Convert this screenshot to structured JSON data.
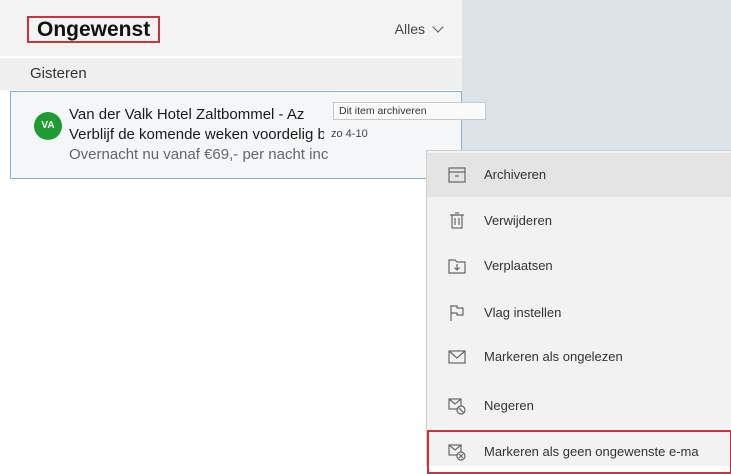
{
  "header": {
    "folder_title": "Ongewenst",
    "filter_label": "Alles"
  },
  "group_header": "Gisteren",
  "mail_item": {
    "avatar_initials": "VA",
    "avatar_color": "#1e9c33",
    "sender": "Van der Valk Hotel Zaltbommel - Az",
    "subject": "Verblijf de komende weken voordelig b",
    "preview": "Overnacht nu vanaf €69,- per nacht inc",
    "date": "zo 4-10"
  },
  "tooltip": "Dit item archiveren",
  "context_menu": {
    "items": [
      {
        "label": "Archiveren",
        "icon": "archive-icon"
      },
      {
        "label": "Verwijderen",
        "icon": "trash-icon"
      },
      {
        "label": "Verplaatsen",
        "icon": "move-icon"
      },
      {
        "label": "Vlag instellen",
        "icon": "flag-icon"
      },
      {
        "label": "Markeren als ongelezen",
        "icon": "envelope-icon"
      },
      {
        "label": "Negeren",
        "icon": "ignore-icon"
      },
      {
        "label": "Markeren als geen ongewenste e-ma",
        "icon": "not-junk-icon"
      }
    ]
  },
  "colors": {
    "highlight_border": "#c8343d",
    "selection_border": "#7fb2df"
  }
}
